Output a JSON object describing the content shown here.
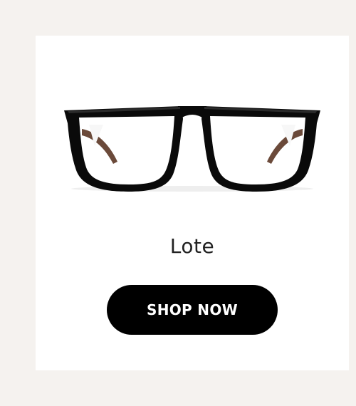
{
  "product": {
    "name": "Lote",
    "image_icon": "eyeglasses-icon",
    "frame_color": "#0a0a0a",
    "temple_color": "#6b4a3a"
  },
  "cta": {
    "label": "SHOP NOW"
  },
  "colors": {
    "page_background": "#f5f2ef",
    "card_background": "#ffffff",
    "button_background": "#000000",
    "button_text": "#ffffff"
  }
}
